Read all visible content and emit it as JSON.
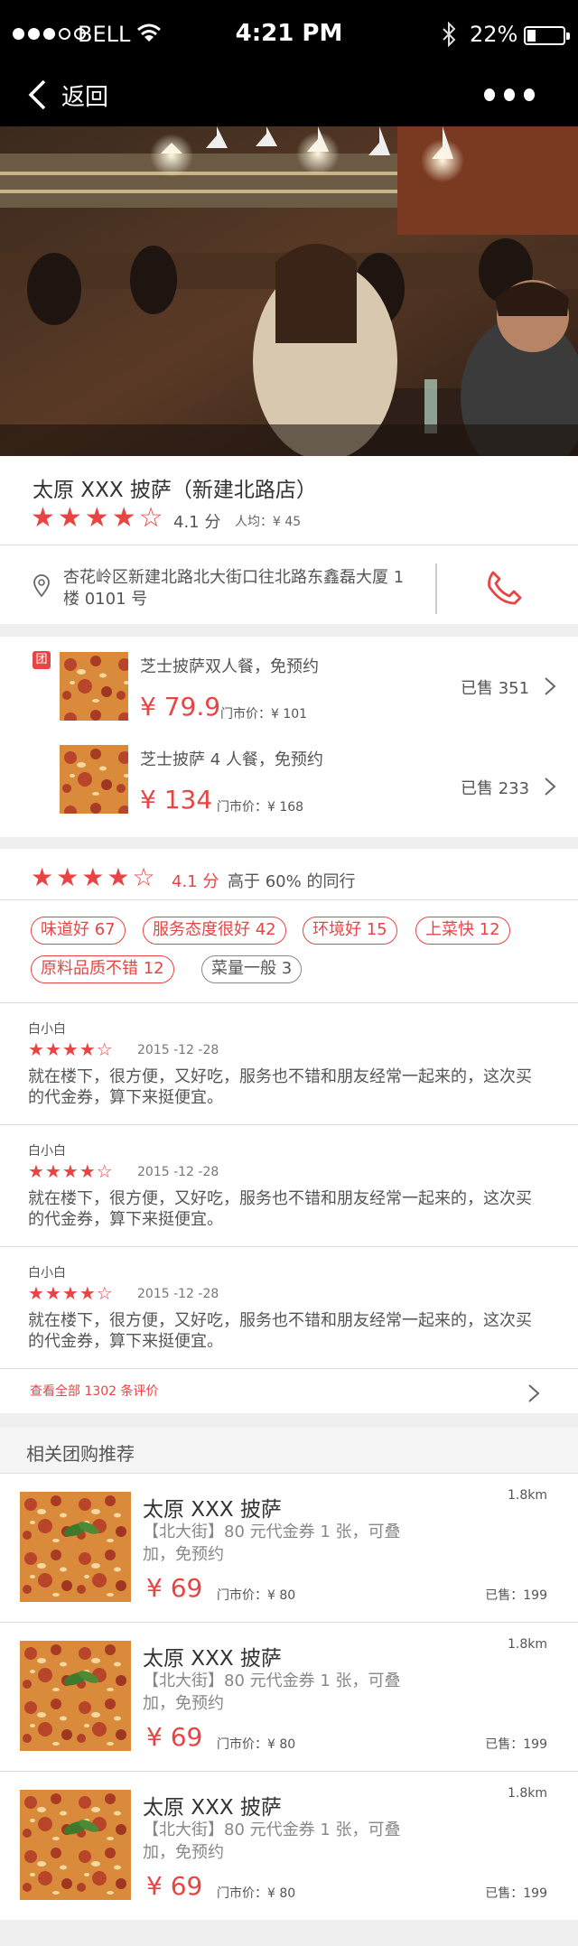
{
  "status_bar": {
    "carrier": "BELL",
    "time": "4:21 PM",
    "battery": "22%"
  },
  "nav": {
    "back_label": "返回"
  },
  "store": {
    "name": "太原 XXX 披萨（新建北路店）",
    "score": "4.1 分",
    "avg_price": "人均：¥ 45",
    "rating_stars": 4,
    "address": "杏花岭区新建北路北大街口往北路东鑫磊大厦 1 楼 0101 号"
  },
  "deals": {
    "badge": "团",
    "items": [
      {
        "title": "芝士披萨双人餐，免预约",
        "price": "¥ 79.9",
        "orig_price": "门市价：¥ 101",
        "sold": "已售 351"
      },
      {
        "title": "芝士披萨 4 人餐，免预约",
        "price": "¥ 134",
        "orig_price": "门市价：¥ 168",
        "sold": "已售 233"
      }
    ]
  },
  "rating_summary": {
    "score": "4.1 分",
    "compare": "高于 60% 的同行",
    "tags": [
      {
        "label": "味道好 67"
      },
      {
        "label": "服务态度很好 42"
      },
      {
        "label": "环境好 15"
      },
      {
        "label": "上菜快 12"
      },
      {
        "label": "原料品质不错 12"
      },
      {
        "label": "菜量一般 3"
      }
    ]
  },
  "reviews": [
    {
      "user": "白小白",
      "stars": 4,
      "date": "2015 -12 -28",
      "text": "就在楼下，很方便，又好吃，服务也不错和朋友经常一起来的，这次买的代金券，算下来挺便宜。"
    },
    {
      "user": "白小白",
      "stars": 4,
      "date": "2015 -12 -28",
      "text": "就在楼下，很方便，又好吃，服务也不错和朋友经常一起来的，这次买的代金券，算下来挺便宜。"
    },
    {
      "user": "白小白",
      "stars": 4,
      "date": "2015 -12 -28",
      "text": "就在楼下，很方便，又好吃，服务也不错和朋友经常一起来的，这次买的代金券，算下来挺便宜。"
    }
  ],
  "all_reviews_link": "查看全部 1302 条评价",
  "related": {
    "heading": "相关团购推荐",
    "items": [
      {
        "title": "太原 XXX 披萨",
        "desc": "【北大街】80 元代金券 1 张，可叠加，免预约",
        "price": "¥ 69",
        "orig_price": "门市价：¥ 80",
        "distance": "1.8km",
        "sold": "已售：199"
      },
      {
        "title": "太原 XXX 披萨",
        "desc": "【北大街】80 元代金券 1 张，可叠加，免预约",
        "price": "¥ 69",
        "orig_price": "门市价：¥ 80",
        "distance": "1.8km",
        "sold": "已售：199"
      },
      {
        "title": "太原 XXX 披萨",
        "desc": "【北大街】80 元代金券 1 张，可叠加，免预约",
        "price": "¥ 69",
        "orig_price": "门市价：¥ 80",
        "distance": "1.8km",
        "sold": "已售：199"
      }
    ]
  },
  "colors": {
    "accent": "#e84444",
    "background": "#efefef",
    "topbar": "#000000"
  }
}
